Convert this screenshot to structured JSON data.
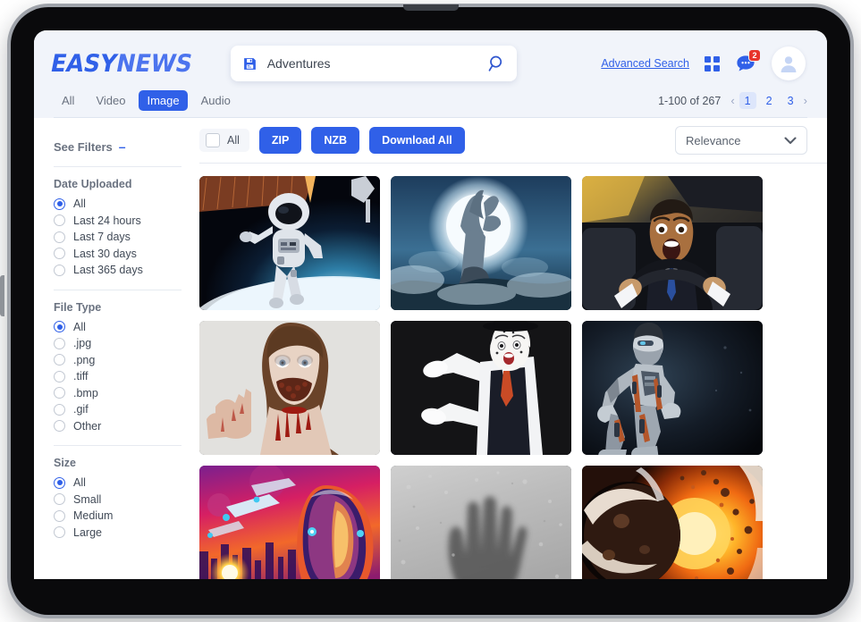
{
  "brand": {
    "name_part1": "EASY",
    "name_part2": "NEWS",
    "accent": "#3060e8"
  },
  "search": {
    "value": "Adventures",
    "save_icon": "save-icon",
    "search_icon": "search-icon"
  },
  "header": {
    "advanced_search": "Advanced Search",
    "grid_icon": "grid-view-icon",
    "chat_icon": "chat-icon",
    "chat_badge": "2",
    "avatar_icon": "user-avatar-icon"
  },
  "tabs": [
    {
      "label": "All",
      "active": false
    },
    {
      "label": "Video",
      "active": false
    },
    {
      "label": "Image",
      "active": true
    },
    {
      "label": "Audio",
      "active": false
    }
  ],
  "pagination": {
    "count_text": "1-100 of 267",
    "prev": "‹",
    "pages": [
      "1",
      "2",
      "3"
    ],
    "current": "1",
    "next": "›"
  },
  "sidebar": {
    "see_filters_label": "See Filters",
    "collapse_glyph": "–",
    "groups": [
      {
        "title": "Date Uploaded",
        "options": [
          {
            "label": "All",
            "selected": true
          },
          {
            "label": "Last 24 hours",
            "selected": false
          },
          {
            "label": "Last 7 days",
            "selected": false
          },
          {
            "label": "Last 30 days",
            "selected": false
          },
          {
            "label": "Last 365 days",
            "selected": false
          }
        ]
      },
      {
        "title": "File Type",
        "options": [
          {
            "label": "All",
            "selected": true
          },
          {
            "label": ".jpg",
            "selected": false
          },
          {
            "label": ".png",
            "selected": false
          },
          {
            "label": ".tiff",
            "selected": false
          },
          {
            "label": ".bmp",
            "selected": false
          },
          {
            "label": ".gif",
            "selected": false
          },
          {
            "label": "Other",
            "selected": false
          }
        ]
      },
      {
        "title": "Size",
        "options": [
          {
            "label": "All",
            "selected": true
          },
          {
            "label": "Small",
            "selected": false
          },
          {
            "label": "Medium",
            "selected": false
          },
          {
            "label": "Large",
            "selected": false
          }
        ]
      }
    ]
  },
  "toolbar": {
    "select_all_label": "All",
    "zip_label": "ZIP",
    "nzb_label": "NZB",
    "download_all_label": "Download All",
    "sort_value": "Relevance",
    "sort_icon": "chevron-down-icon"
  },
  "results": [
    {
      "name": "astronaut-spacewalk"
    },
    {
      "name": "zombie-hand-moon"
    },
    {
      "name": "screaming-driver"
    },
    {
      "name": "zombie-woman"
    },
    {
      "name": "mime-performer"
    },
    {
      "name": "kneeling-robot"
    },
    {
      "name": "retro-sci-fi-astronaut"
    },
    {
      "name": "hand-behind-frosted-glass"
    },
    {
      "name": "exploding-planet"
    }
  ]
}
